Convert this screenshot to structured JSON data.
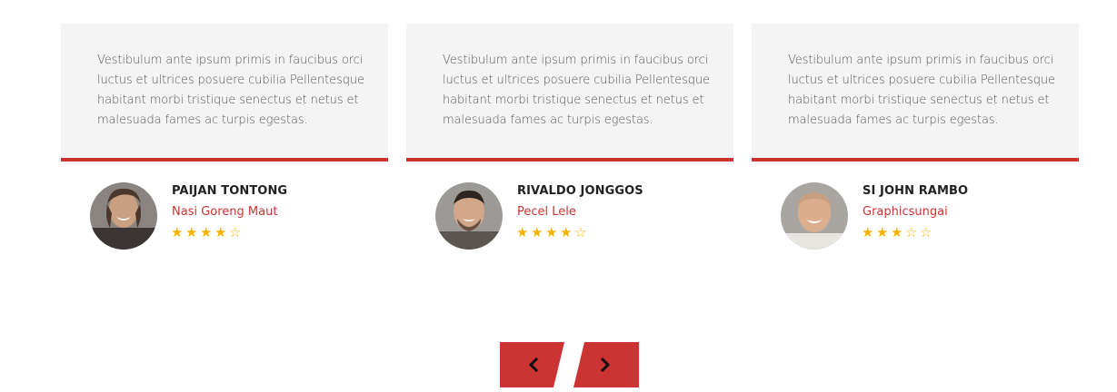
{
  "testimonials": [
    {
      "quote": "Vestibulum ante ipsum primis in faucibus orci luctus et ultrices posuere cubilia Pellentesque habitant morbi tristique senectus et netus et malesuada fames ac turpis egestas.",
      "name": "PAIJAN TONTONG",
      "company": "Nasi Goreng Maut",
      "rating": 4,
      "rating_max": 5
    },
    {
      "quote": "Vestibulum ante ipsum primis in faucibus orci luctus et ultrices posuere cubilia Pellentesque habitant morbi tristique senectus et netus et malesuada fames ac turpis egestas.",
      "name": "RIVALDO JONGGOS",
      "company": "Pecel Lele",
      "rating": 4,
      "rating_max": 5
    },
    {
      "quote": "Vestibulum ante ipsum primis in faucibus orci luctus et ultrices posuere cubilia Pellentesque habitant morbi tristique senectus et netus et malesuada fames ac turpis egestas.",
      "name": "SI JOHN RAMBO",
      "company": "Graphicsungai",
      "rating": 3,
      "rating_max": 5
    }
  ],
  "navigation": {
    "prev_icon": "chevron-left-icon",
    "next_icon": "chevron-right-icon"
  },
  "colors": {
    "accent": "#cc3333",
    "star": "#f5b301",
    "card_bg": "#f4f4f4"
  }
}
